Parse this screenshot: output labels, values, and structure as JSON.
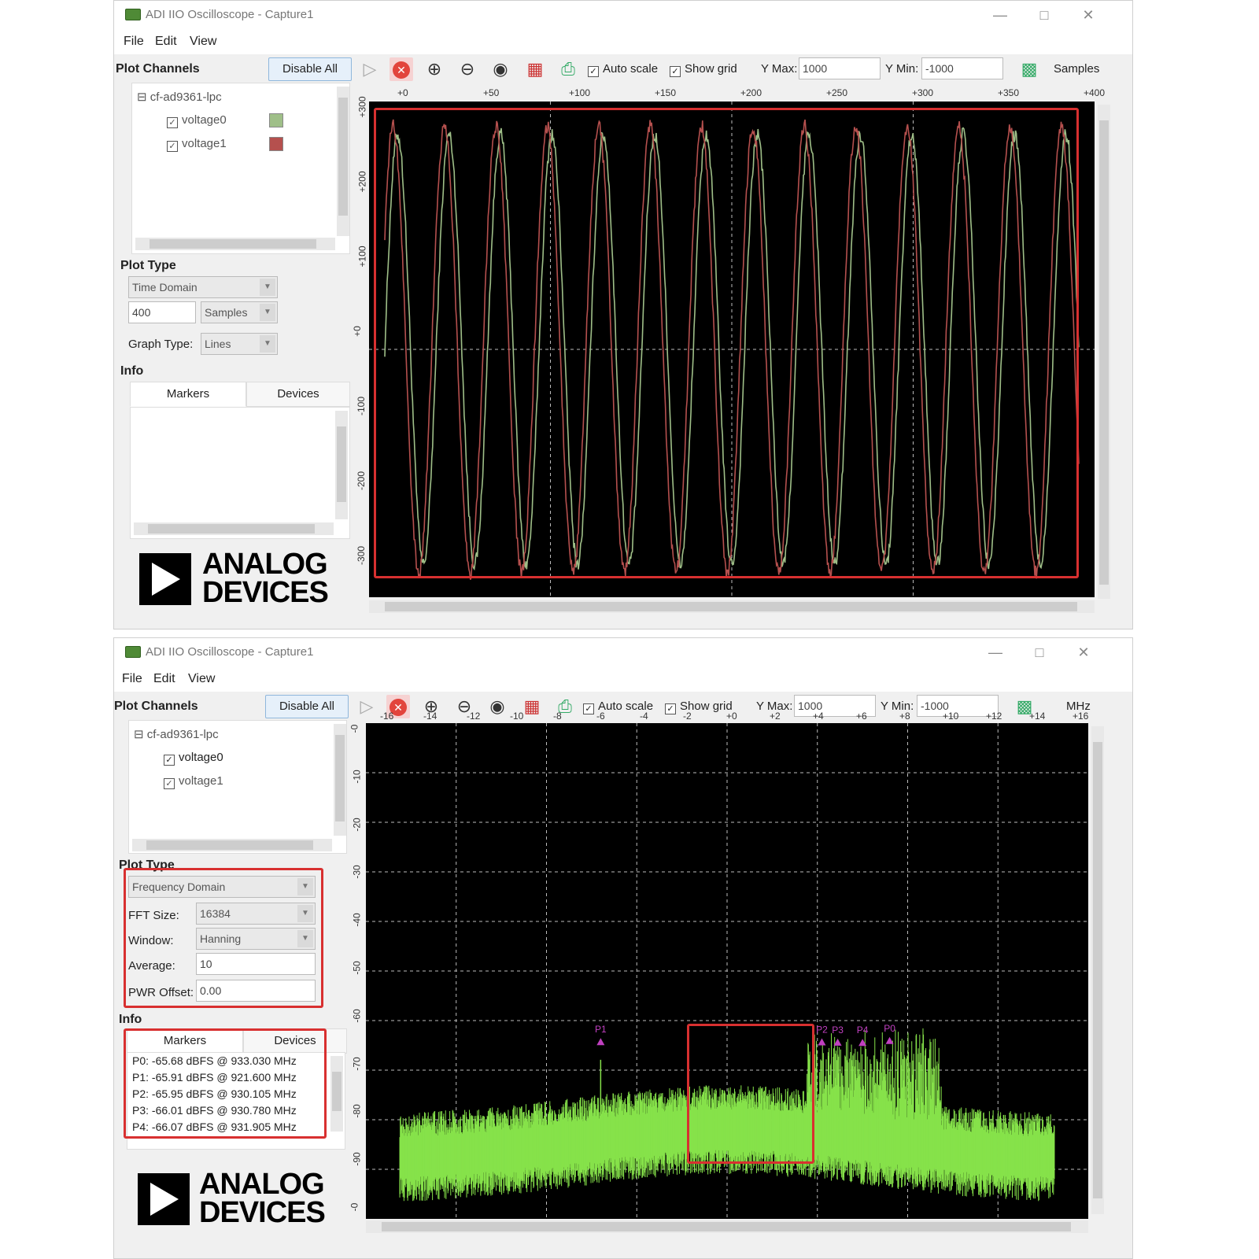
{
  "colors": {
    "voltage0": "#9fbf88",
    "voltage1": "#b5504e",
    "spectrum": "#86e24a",
    "marker": "#c040c0",
    "highlight": "#d83030"
  },
  "window1": {
    "title": "ADI IIO Oscilloscope - Capture1",
    "menu": [
      "File",
      "Edit",
      "View"
    ],
    "plot_channels_label": "Plot Channels",
    "disable_all": "Disable All",
    "auto_scale": "Auto scale",
    "show_grid": "Show grid",
    "ymax_label": "Y Max:",
    "ymax_value": "1000",
    "ymin_label": "Y Min:",
    "ymin_value": "-1000",
    "units": "Samples",
    "device": "cf-ad9361-lpc",
    "channels": [
      {
        "label": "voltage0",
        "checked": true
      },
      {
        "label": "voltage1",
        "checked": true
      }
    ],
    "plot_type_label": "Plot Type",
    "plot_type": "Time Domain",
    "sample_count": "400",
    "sample_unit": "Samples",
    "graph_type_label": "Graph Type:",
    "graph_type": "Lines",
    "info_label": "Info",
    "tabs": [
      "Markers",
      "Devices"
    ],
    "logo_line1": "ANALOG",
    "logo_line2": "DEVICES",
    "x_ticks": [
      "+0",
      "+50",
      "+100",
      "+150",
      "+200",
      "+250",
      "+300",
      "+350",
      "+400"
    ],
    "y_ticks": [
      "+300",
      "+200",
      "+100",
      "+0",
      "-100",
      "-200",
      "-300"
    ]
  },
  "window2": {
    "title": "ADI IIO Oscilloscope - Capture1",
    "menu": [
      "File",
      "Edit",
      "View"
    ],
    "plot_channels_label": "Plot Channels",
    "disable_all": "Disable All",
    "auto_scale": "Auto scale",
    "show_grid": "Show grid",
    "ymax_label": "Y Max:",
    "ymax_value": "1000",
    "ymin_label": "Y Min:",
    "ymin_value": "-1000",
    "units": "MHz",
    "device": "cf-ad9361-lpc",
    "channels": [
      {
        "label": "voltage0",
        "checked": true
      },
      {
        "label": "voltage1",
        "checked": true
      }
    ],
    "plot_type_label": "Plot Type",
    "plot_type": "Frequency Domain",
    "fft_label": "FFT Size:",
    "fft_value": "16384",
    "window_label": "Window:",
    "window_value": "Hanning",
    "average_label": "Average:",
    "average_value": "10",
    "pwr_label": "PWR Offset:",
    "pwr_value": "0.00",
    "info_label": "Info",
    "tabs": [
      "Markers",
      "Devices"
    ],
    "markers": [
      "P0: -65.68 dBFS @ 933.030 MHz",
      "P1: -65.91 dBFS @ 921.600 MHz",
      "P2: -65.95 dBFS @ 930.105 MHz",
      "P3: -66.01 dBFS @ 930.780 MHz",
      "P4: -66.07 dBFS @ 931.905 MHz"
    ],
    "marker_tags": [
      "P1",
      "P2",
      "P3",
      "P4",
      "P0"
    ],
    "logo_line1": "ANALOG",
    "logo_line2": "DEVICES",
    "x_ticks": [
      "-16",
      "-14",
      "-12",
      "-10",
      "-8",
      "-6",
      "-4",
      "-2",
      "+0",
      "+2",
      "+4",
      "+6",
      "+8",
      "+10",
      "+12",
      "+14",
      "+16"
    ],
    "y_ticks": [
      "-0",
      "-10",
      "-20",
      "-30",
      "-40",
      "-50",
      "-60",
      "-70",
      "-80",
      "-90",
      "-0"
    ]
  },
  "chart_data": [
    {
      "type": "line",
      "xlim": [
        0,
        400
      ],
      "ylim": [
        -300,
        300
      ],
      "grid": true,
      "series": [
        {
          "name": "voltage0",
          "cycles": 13.5,
          "amplitude": 260,
          "phase": 0
        },
        {
          "name": "voltage1",
          "cycles": 13.5,
          "amplitude": 270,
          "phase": 0.55
        }
      ]
    },
    {
      "type": "line",
      "x_unit": "MHz",
      "xlim": [
        -16,
        16
      ],
      "ylim": [
        -100,
        0
      ],
      "grid": true,
      "series": [
        {
          "name": "voltage0",
          "floor": -82,
          "edge": -88,
          "band": [
            3.5,
            9.5
          ],
          "band_level": -72
        }
      ],
      "markers": [
        {
          "name": "P0",
          "dbfs": -65.68,
          "mhz": 933.03
        },
        {
          "name": "P1",
          "dbfs": -65.91,
          "mhz": 921.6
        },
        {
          "name": "P2",
          "dbfs": -65.95,
          "mhz": 930.105
        },
        {
          "name": "P3",
          "dbfs": -66.01,
          "mhz": 930.78
        },
        {
          "name": "P4",
          "dbfs": -66.07,
          "mhz": 931.905
        }
      ]
    }
  ]
}
